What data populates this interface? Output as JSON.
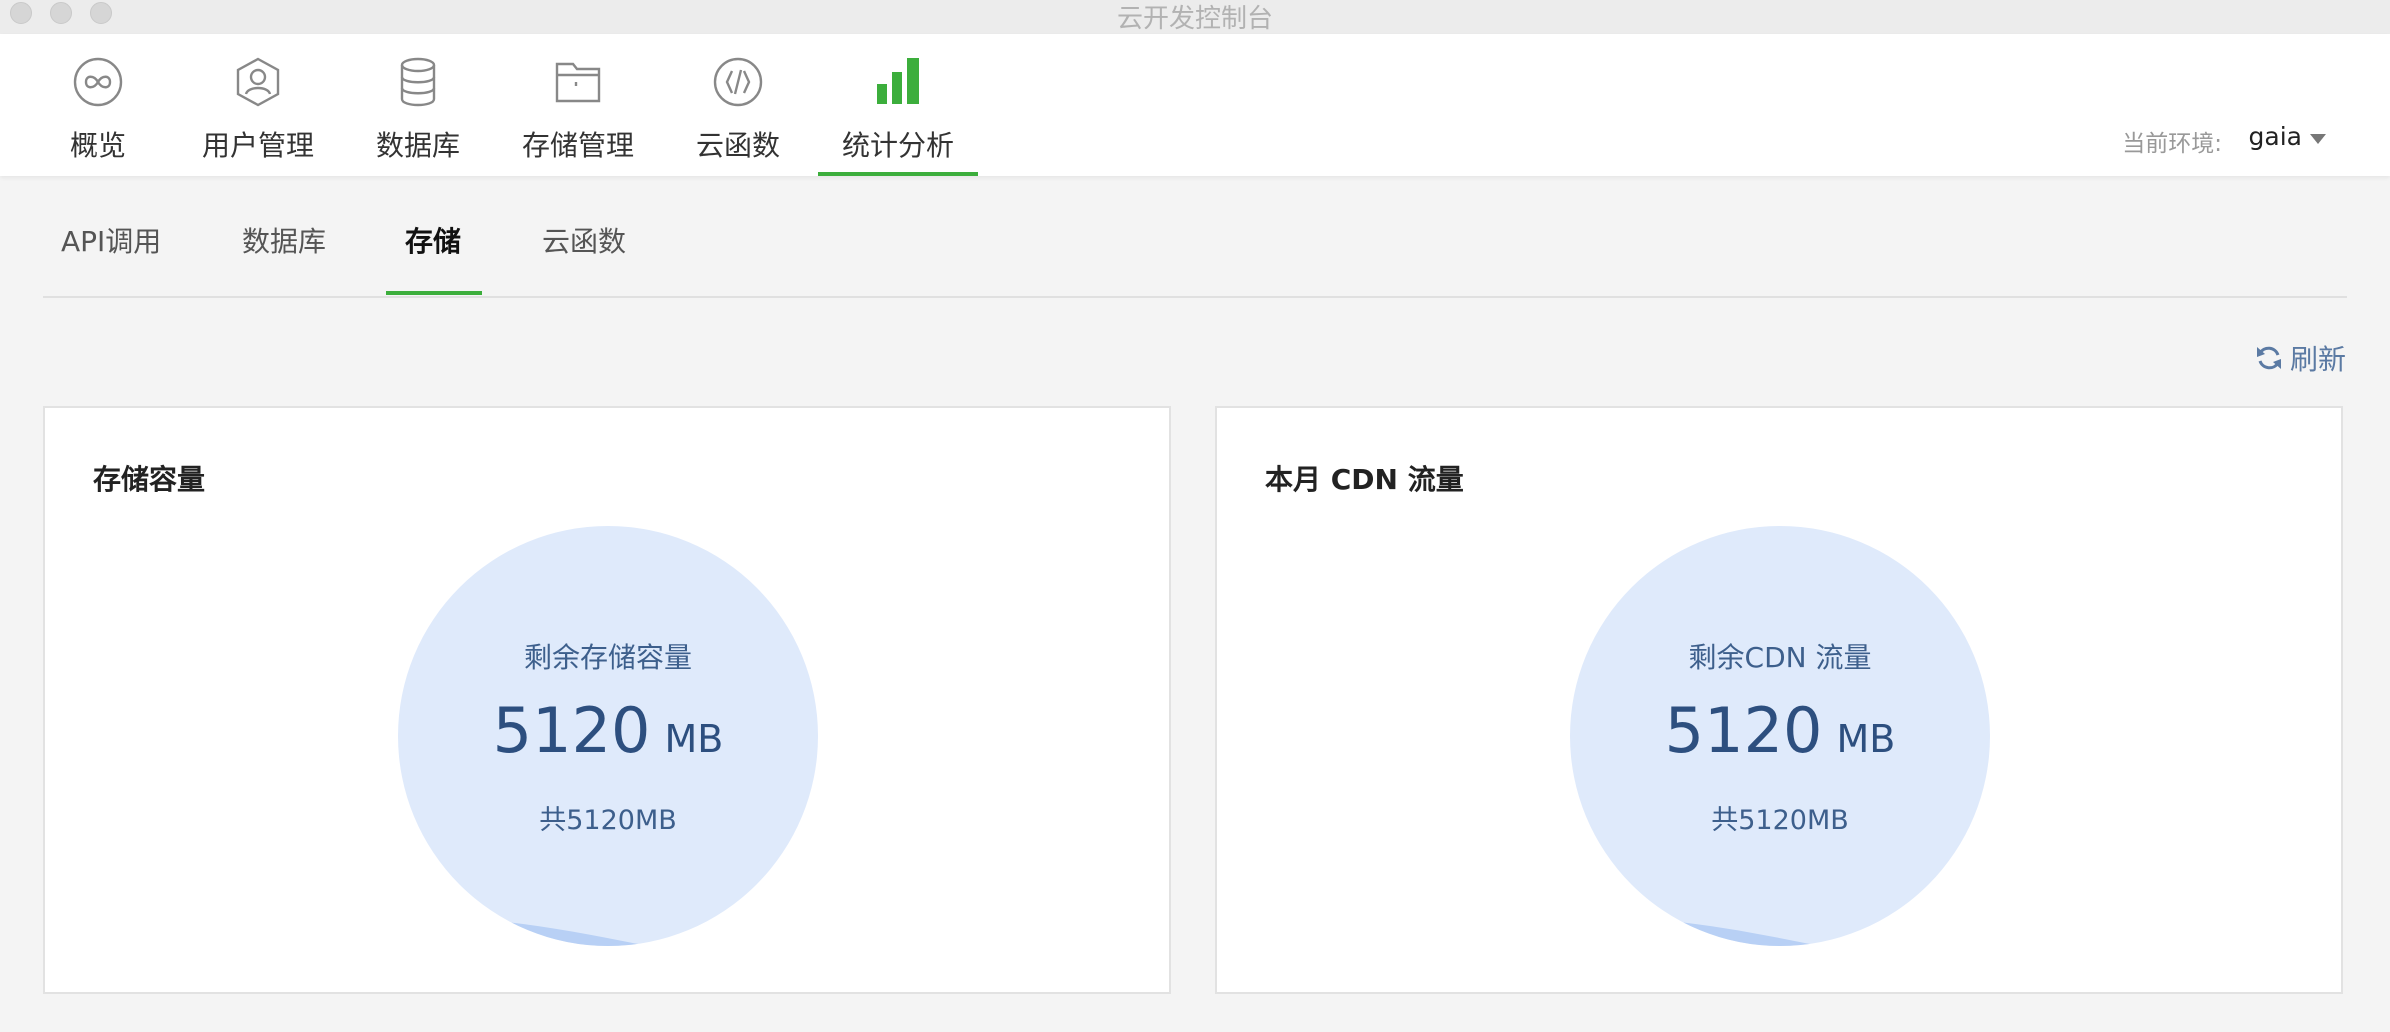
{
  "window": {
    "title": "云开发控制台"
  },
  "topnav": {
    "items": [
      {
        "label": "概览",
        "icon": "overview-infinity-icon"
      },
      {
        "label": "用户管理",
        "icon": "user-icon"
      },
      {
        "label": "数据库",
        "icon": "database-icon"
      },
      {
        "label": "存储管理",
        "icon": "folder-icon"
      },
      {
        "label": "云函数",
        "icon": "function-code-icon"
      },
      {
        "label": "统计分析",
        "icon": "bar-chart-icon",
        "active": true
      }
    ],
    "env_label": "当前环境:",
    "env_value": "gaia"
  },
  "subtabs": {
    "items": [
      {
        "label": "API调用"
      },
      {
        "label": "数据库"
      },
      {
        "label": "存储",
        "active": true
      },
      {
        "label": "云函数"
      }
    ]
  },
  "refresh_label": "刷新",
  "cards": [
    {
      "title": "存储容量",
      "circle_label": "剩余存储容量",
      "value": "5120",
      "unit": "MB",
      "total": "共5120MB"
    },
    {
      "title": "本月 CDN 流量",
      "circle_label": "剩余CDN 流量",
      "value": "5120",
      "unit": "MB",
      "total": "共5120MB"
    }
  ],
  "colors": {
    "accent_green": "#3cae3c",
    "circle_fill": "#dfeafb",
    "circle_text": "#2d4f7f",
    "link_blue": "#5b7aa3"
  }
}
